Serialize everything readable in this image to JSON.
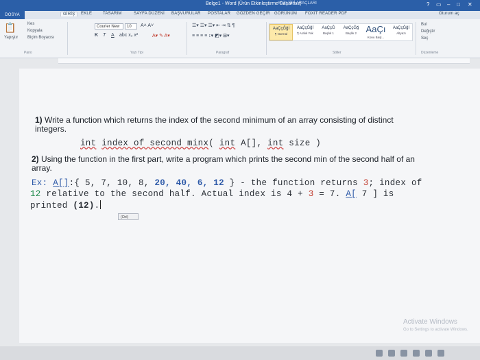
{
  "window": {
    "title": "Belge1 - Word (Ürün Etkinleştirme Başarısız)",
    "title_right": "YAZI TİPİ ARAÇLARI",
    "controls": [
      "?",
      "▭",
      "–",
      "□",
      "✕"
    ],
    "user": "Oturum aç"
  },
  "tabs": {
    "file": "DOSYA",
    "items": [
      "GİRİŞ",
      "EKLE",
      "TASARIM",
      "SAYFA DÜZENİ",
      "BAŞVURULAR",
      "POSTALAR",
      "GÖZDEN GEÇİR",
      "GÖRÜNÜM",
      "FOXIT READER PDF"
    ]
  },
  "ribbon": {
    "clipboard": {
      "paste": "Yapıştır",
      "cut": "Kes",
      "copy": "Kopyala",
      "format_painter": "Biçim Boyacısı",
      "group": "Pano"
    },
    "font": {
      "name": "Courier New",
      "size": "10",
      "group": "Yazı Tipi",
      "bold": "K",
      "italic": "T",
      "underline": "A"
    },
    "paragraph": {
      "group": "Paragraf"
    },
    "styles": {
      "group": "Stiller",
      "items": [
        {
          "sample": "AaÇçĞğİ",
          "name": "¶ Normal"
        },
        {
          "sample": "AaÇçĞğİ",
          "name": "¶ Aralık Yok"
        },
        {
          "sample": "AaÇçĞ",
          "name": "Başlık 1"
        },
        {
          "sample": "AaÇçĞğ",
          "name": "Başlık 2"
        },
        {
          "sample": "AaÇı",
          "name": "Konu Başl..."
        },
        {
          "sample": "AaÇçĞğİ",
          "name": "Altyazı"
        }
      ]
    },
    "editing": {
      "find": "Bul",
      "replace": "Değiştir",
      "select": "Seç",
      "group": "Düzenleme"
    }
  },
  "document": {
    "q1_prefix": "1)",
    "q1_text": " Write a function which returns the index of the second minimum of an array consisting of distinct",
    "q1_cont": "integers.",
    "signature": {
      "t1": "int",
      "t2": "index of second minx",
      "t3": "( ",
      "t4": "int",
      "t5": " A[], ",
      "t6": "int",
      "t7": " size )"
    },
    "q2_prefix": "2)",
    "q2_text": " Using the function in the first part, write a program which prints the second min of the second half of an",
    "q2_cont": "array.",
    "ex": {
      "a1": "Ex: ",
      "a2": "A[]",
      "a3": ":{ 5, 7, 10, 8, ",
      "a4": "20, 40, 6, 12",
      "a5": " } - the function returns ",
      "a6": "3",
      "a7": "; index of"
    },
    "ex2": {
      "b1": "12",
      "b2": " relative to the second half. Actual index is ",
      "b3": "4",
      "b4": " + ",
      "b5": "3",
      "b6": " = 7. ",
      "b7": "A[",
      "b8": " 7 ] is"
    },
    "ex3": {
      "c1": "printed ",
      "c2": "(12)",
      "c3": "."
    },
    "paste_badge": "(Ctrl)"
  },
  "watermark": {
    "title": "Activate Windows",
    "subtitle": "Go to Settings to activate Windows."
  },
  "colors": {
    "titlebar": "#2b5fa8",
    "page": "#f5f6f8",
    "keyword": "#2e5aa8",
    "number": "#c0392b"
  }
}
